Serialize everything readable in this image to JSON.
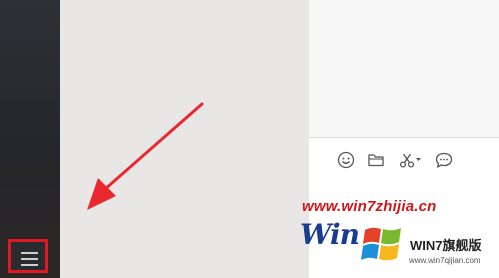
{
  "sidebar": {
    "menu_icon": "hamburger-menu-icon",
    "highlight_color": "#e0191f"
  },
  "annotation": {
    "arrow_color": "#e8282c"
  },
  "chat": {
    "toolbar": [
      {
        "name": "emoji-icon"
      },
      {
        "name": "folder-icon"
      },
      {
        "name": "scissors-icon"
      },
      {
        "name": "chat-bubble-icon"
      }
    ]
  },
  "watermark": {
    "url": "www.win7zhijia.cn",
    "big": "Win",
    "brand": "WIN7旗舰版",
    "site": "www.win7qijian.com"
  }
}
